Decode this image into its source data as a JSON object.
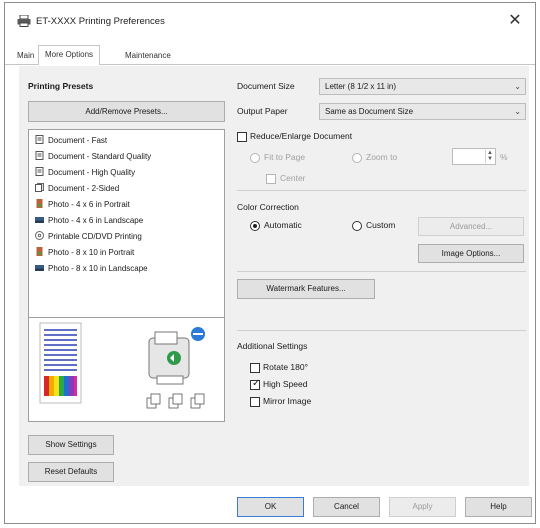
{
  "window": {
    "title": "ET-XXXX Printing Preferences",
    "close_glyph": "✕"
  },
  "tabs": [
    {
      "label": "Main"
    },
    {
      "label": "More Options"
    },
    {
      "label": "Maintenance"
    }
  ],
  "presets": {
    "heading": "Printing Presets",
    "add_remove_label": "Add/Remove Presets...",
    "items": [
      {
        "label": "Document - Fast",
        "icon": "document-icon"
      },
      {
        "label": "Document - Standard Quality",
        "icon": "document-icon"
      },
      {
        "label": "Document - High Quality",
        "icon": "document-icon"
      },
      {
        "label": "Document - 2-Sided",
        "icon": "two-sided-document-icon"
      },
      {
        "label": "Photo - 4 x 6 in Portrait",
        "icon": "photo-portrait-icon"
      },
      {
        "label": "Photo - 4 x 6 in Landscape",
        "icon": "photo-landscape-icon"
      },
      {
        "label": "Printable CD/DVD Printing",
        "icon": "cd-icon"
      },
      {
        "label": "Photo - 8 x 10 in Portrait",
        "icon": "photo-portrait-icon"
      },
      {
        "label": "Photo - 8 x 10 in Landscape",
        "icon": "photo-landscape-icon"
      }
    ]
  },
  "left_buttons": {
    "show_settings": "Show Settings",
    "reset_defaults": "Reset Defaults"
  },
  "document_size": {
    "label": "Document Size",
    "value": "Letter (8 1/2 x 11 in)"
  },
  "output_paper": {
    "label": "Output Paper",
    "value": "Same as Document Size"
  },
  "reduce_enlarge": {
    "label": "Reduce/Enlarge Document",
    "checked": false,
    "fit_to_page": "Fit to Page",
    "zoom_to": "Zoom to",
    "percent_unit": "%",
    "center": "Center"
  },
  "color_correction": {
    "heading": "Color Correction",
    "automatic": "Automatic",
    "custom": "Custom",
    "selected": "Automatic",
    "advanced_label": "Advanced...",
    "image_options_label": "Image Options..."
  },
  "watermark_label": "Watermark Features...",
  "additional": {
    "heading": "Additional Settings",
    "rotate": {
      "label": "Rotate 180°",
      "checked": false
    },
    "high_speed": {
      "label": "High Speed",
      "checked": true
    },
    "mirror": {
      "label": "Mirror Image",
      "checked": false
    }
  },
  "dialog_buttons": {
    "ok": "OK",
    "cancel": "Cancel",
    "apply": "Apply",
    "help": "Help"
  },
  "colors": {
    "panel_bg": "#f0f0f0",
    "button_bg": "#e1e1e1",
    "preview_lines": "#2c3fb0",
    "info_badge": "#2a7ad8"
  },
  "chevron_glyph": "⌄",
  "check_glyph": "✓"
}
